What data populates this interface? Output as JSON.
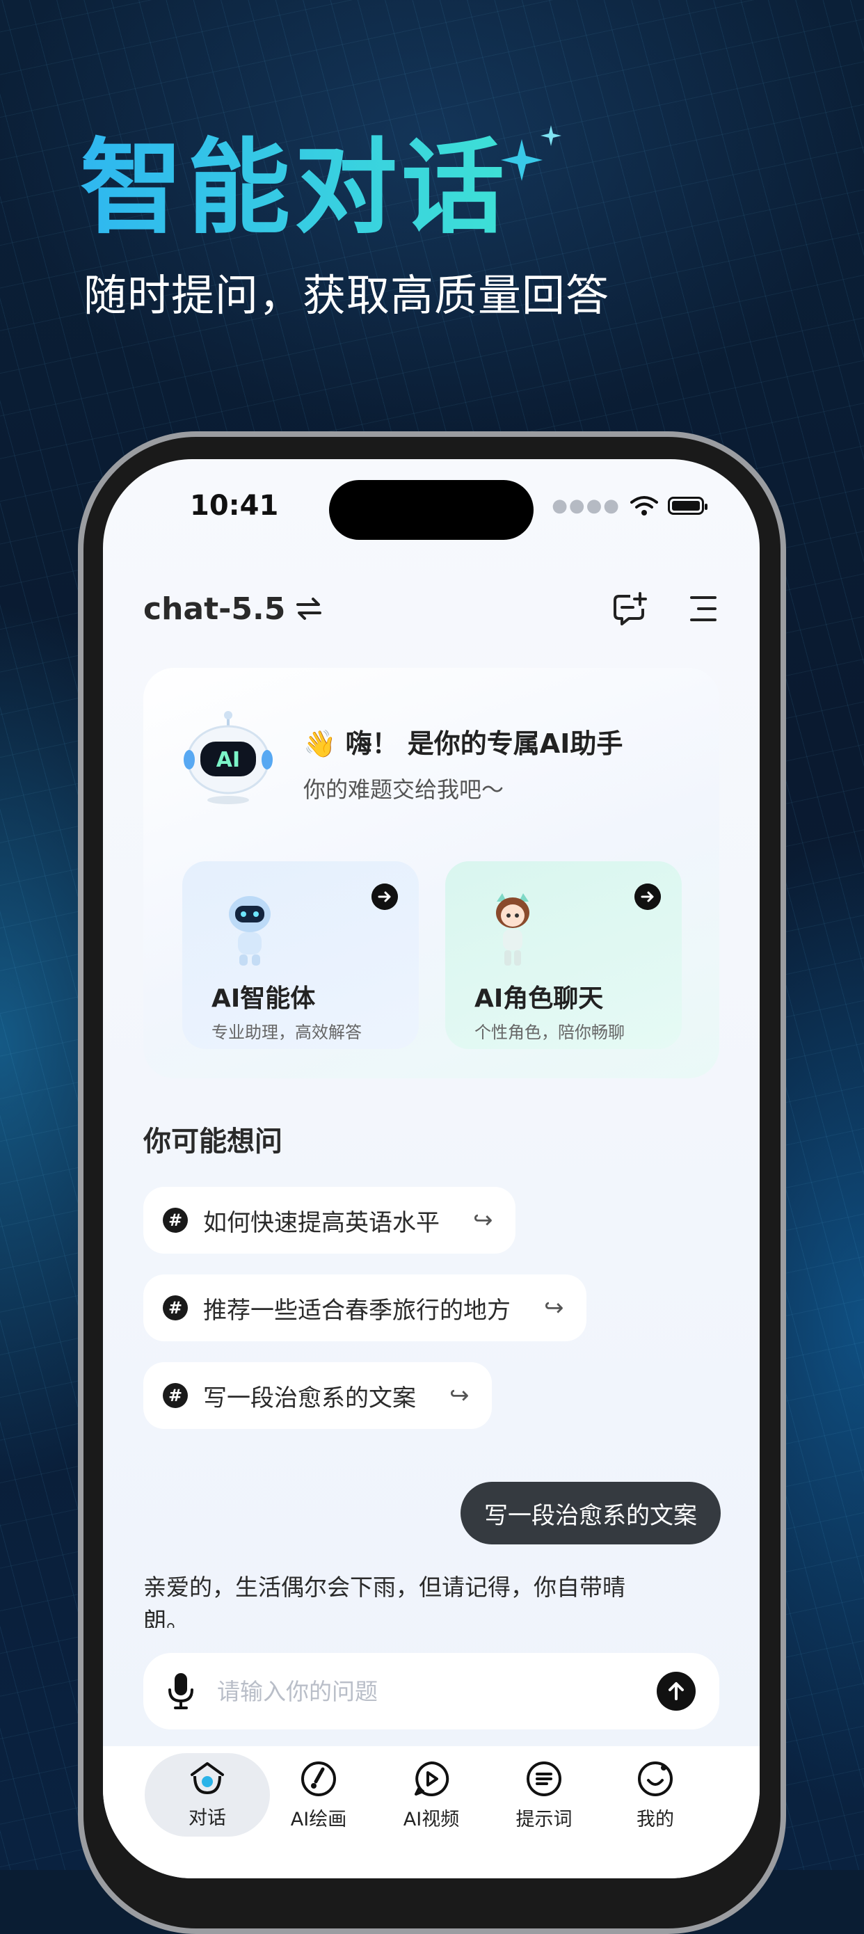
{
  "promo": {
    "title": "智能对话",
    "subtitle": "随时提问，获取高质量回答"
  },
  "status": {
    "time": "10:41",
    "dots": "●●●●"
  },
  "header": {
    "model_name": "chat-5.5",
    "switch_icon": "swap-arrows-icon",
    "new_chat_icon": "new-chat-icon",
    "menu_icon": "menu-icon"
  },
  "welcome": {
    "wave": "👋",
    "greeting": "嗨！ 是你的专属AI助手",
    "subtext": "你的难题交给我吧～",
    "avatar_label": "AI",
    "cards": [
      {
        "title": "AI智能体",
        "subtitle": "专业助理，高效解答"
      },
      {
        "title": "AI角色聊天",
        "subtitle": "个性角色，陪你畅聊"
      }
    ]
  },
  "suggestions": {
    "heading": "你可能想问",
    "hash_glyph": "#",
    "go_glyph": "↪",
    "items": [
      {
        "text": "如何快速提高英语水平"
      },
      {
        "text": "推荐一些适合春季旅行的地方"
      },
      {
        "text": "写一段治愈系的文案"
      }
    ]
  },
  "chat": {
    "user_message": "写一段治愈系的文案",
    "assistant_reply": "亲爱的，生活偶尔会下雨，但请记得，你自带晴朗。"
  },
  "input": {
    "placeholder": "请输入你的问题"
  },
  "tabs": [
    {
      "label": "对话",
      "icon": "chat-tab-icon",
      "active": true
    },
    {
      "label": "AI绘画",
      "icon": "brush-tab-icon",
      "active": false
    },
    {
      "label": "AI视频",
      "icon": "video-play-tab-icon",
      "active": false
    },
    {
      "label": "提示词",
      "icon": "prompt-tab-icon",
      "active": false
    },
    {
      "label": "我的",
      "icon": "smile-profile-icon",
      "active": false
    }
  ],
  "colors": {
    "title_gradient_start": "#2fb7f0",
    "title_gradient_end": "#3ee0d6",
    "card_blue": "#e5f0fd",
    "card_green": "#d9f6ef",
    "bubble_dark": "#353a40"
  }
}
